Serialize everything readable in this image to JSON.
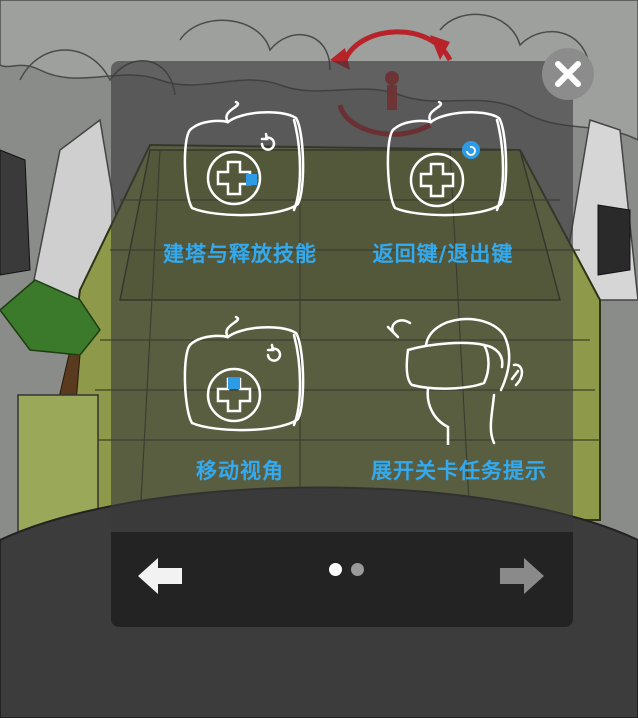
{
  "tutorial": {
    "tiles": [
      {
        "label": "建塔与释放技能",
        "icon": "controller-dpad-center-icon"
      },
      {
        "label": "返回键/退出键",
        "icon": "controller-back-button-icon"
      },
      {
        "label": "移动视角",
        "icon": "controller-dpad-touch-icon"
      },
      {
        "label": "展开关卡任务提示",
        "icon": "vr-headset-head-turn-icon"
      }
    ],
    "pagination": {
      "current_page": 1,
      "total_pages": 2
    },
    "nav": {
      "prev_icon": "arrow-left-icon",
      "next_icon": "arrow-right-icon"
    },
    "close_icon": "close-icon"
  },
  "colors": {
    "label_blue": "#33aaf0",
    "highlight_blue": "#2e9be6",
    "panel": "#232323",
    "dot_active": "#ffffff",
    "dot_inactive": "#9a9a9a",
    "arrow_prev": "#f2f2f2",
    "arrow_next": "#8a8a8a"
  }
}
